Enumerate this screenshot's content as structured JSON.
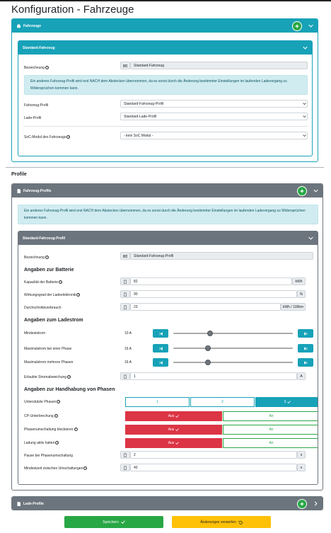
{
  "page": {
    "title": "Konfiguration - Fahrzeuge"
  },
  "fahrzeuge": {
    "header": "Fahrzeuge",
    "vehicle": {
      "header": "Standard-Fahrzeug",
      "bezeichnung_label": "Bezeichnung",
      "bezeichnung_value": "Standard-Fahrzeug",
      "info": "Ein anderes Fahrzeug-Profil wird erst NACH dem Abstecken übernommen, da es sonst durch die Änderung bestimmter Einstellungen im laufenden Ladevorgang zu Widersprüchen kommen kann.",
      "fahrzeugprofil_label": "Fahrzeug-Profil",
      "fahrzeugprofil_value": "Standard-Fahrzeug-Profil",
      "ladeprofil_label": "Lade-Profil",
      "ladeprofil_value": "Standard-Lade-Profil",
      "soc_label": "SoC-Modul des Fahrzeugs",
      "soc_value": "- kein SoC Modul -"
    }
  },
  "profile": {
    "heading": "Profile",
    "fahrzeug_profile": {
      "header": "Fahrzeug-Profile",
      "info": "Ein anderes Fahrzeug-Profil wird erst NACH dem Abstecken übernommen, da es sonst durch die Änderung bestimmter Einstellungen im laufenden Ladevorgang zu Widersprüchen kommen kann.",
      "profil": {
        "header": "Standard-Fahrzeug-Profil",
        "bezeichnung_label": "Bezeichnung",
        "bezeichnung_value": "Standard-Fahrzeug-Profil",
        "batterie_heading": "Angaben zur Batterie",
        "kapazitaet_label": "Kapazität der Batterie",
        "kapazitaet_value": "82",
        "kapazitaet_unit": "kWh",
        "wirkungsgrad_label": "Wirkungsgrad der Ladeelektronik",
        "wirkungsgrad_value": "90",
        "wirkungsgrad_unit": "%",
        "verbrauch_label": "Durchschnittsverbrauch",
        "verbrauch_value": "23",
        "verbrauch_unit": "kWh / 100km",
        "ladestrom_heading": "Angaben zum Ladestrom",
        "min_label": "Mindeststrom",
        "min_value": "10 A",
        "min_level": 0.3,
        "max1_label": "Maximalstrom bei einer Phase",
        "max1_value": "16 A",
        "max1_level": 0.28,
        "maxn_label": "Maximalstrom mehrere Phasen",
        "maxn_value": "16 A",
        "maxn_level": 0.28,
        "abweichung_label": "Erlaubte Stromabweichung",
        "abweichung_value": "1",
        "abweichung_unit": "A",
        "phasen_heading": "Angaben zur Handhabung von Phasen",
        "phasen_label": "Unterstützte Phasen",
        "phasen_options": [
          "1",
          "2",
          "3"
        ],
        "phasen_selected": "3",
        "cp_label": "CP-Unterbrechung",
        "umschaltung_label": "Phasenumschaltung blockieren",
        "ladung_label": "Ladung aktiv halten",
        "aus_label": "Aus",
        "an_label": "An",
        "pause_label": "Pause bei Phasenumschaltung",
        "pause_value": "2",
        "pause_unit": "s",
        "mindestzeit_label": "Mindestzeit zwischen Umschaltungen",
        "mindestzeit_value": "40",
        "mindestzeit_unit": "s"
      }
    },
    "lade_profile": {
      "header": "Lade-Profile"
    }
  },
  "footer": {
    "save_label": "Speichern",
    "revert_label": "Änderungen verwerfen"
  },
  "colors": {
    "teal": "#17a2b8",
    "gray": "#6c757d",
    "green": "#28a745",
    "red": "#dc3545",
    "yellow": "#ffc107"
  }
}
